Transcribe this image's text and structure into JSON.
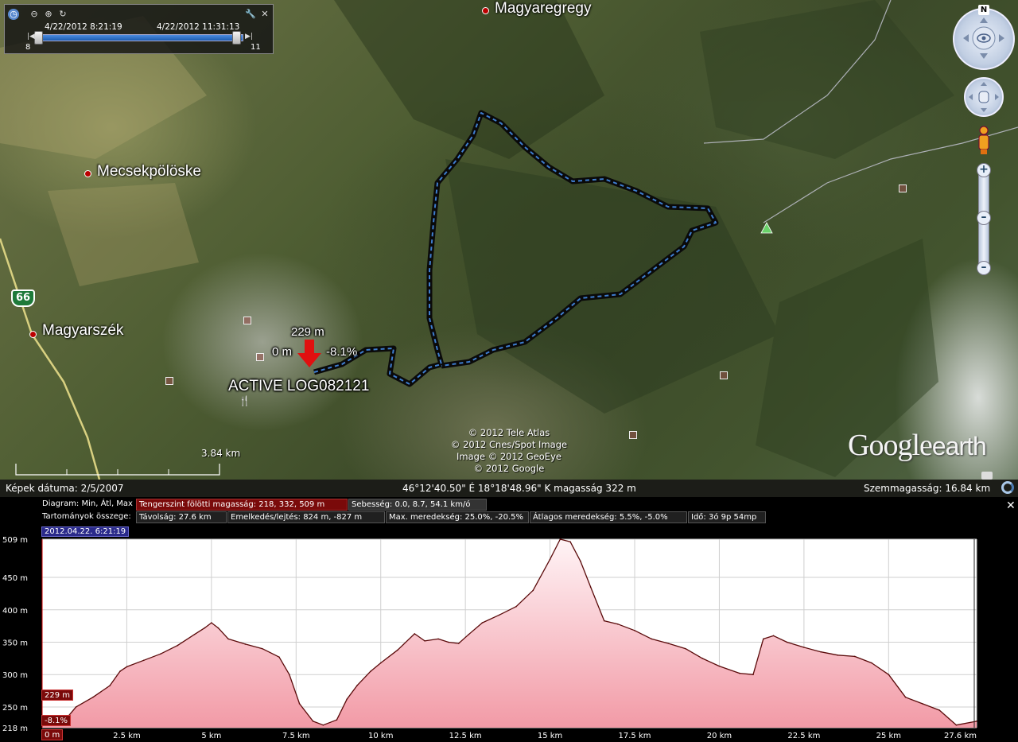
{
  "time_slider": {
    "start_label": "4/22/2012   8:21:19",
    "end_label": "4/22/2012   11:31:13",
    "left_number": "8",
    "right_number": "11",
    "icons": [
      "clock-icon",
      "zoom-out-icon",
      "zoom-in-icon",
      "playback-icon",
      "wrench-icon",
      "close-icon"
    ]
  },
  "map": {
    "places": [
      {
        "name": "Magyaregregy"
      },
      {
        "name": "Mecsekpölöske"
      },
      {
        "name": "Magyarszék"
      }
    ],
    "road_number": "66",
    "track": {
      "start_elev": "229 m",
      "distance": "0 m",
      "slope": "-8.1%",
      "name": "ACTIVE LOG082121"
    },
    "copyright": [
      "© 2012 Tele Atlas",
      "© 2012 Cnes/Spot Image",
      "Image © 2012 GeoEye",
      "© 2012 Google"
    ],
    "logo_google": "Google",
    "logo_earth": "earth",
    "scale_text": "3.84 km",
    "compass_north": "N"
  },
  "status_bar": {
    "image_date": "Képek dátuma: 2/5/2007",
    "coords": "46°12'40.50\" É   18°18'48.96\" K  magasság   322 m",
    "eye_alt": "Szemmagasság:    16.84 km"
  },
  "profile": {
    "row1": {
      "label": "Diagram: Min, Átl, Max",
      "elevation": "Tengerszint fölötti magasság: 218, 332, 509 m",
      "speed": "Sebesség: 0.0, 8.7, 54.1 km/ó"
    },
    "row2": {
      "label": "Tartományok összege:",
      "distance": "Távolság: 27.6 km",
      "gain_loss": "Emelkedés/lejtés: 824 m, -827 m",
      "max_slope": "Max. meredekség: 25.0%, -20.5%",
      "avg_slope": "Átlagos meredekség: 5.5%, -5.0%",
      "time": "Idő: 3ó 9p 54mp"
    },
    "date_badge": "2012.04.22. 6:21:19",
    "cursor_elev": "229 m",
    "cursor_slope": "-8.1%",
    "cursor_dist": "0 m",
    "close_label": "✕"
  },
  "chart_data": {
    "type": "area",
    "title": "",
    "xlabel": "",
    "ylabel": "",
    "x_unit": "km",
    "y_unit": "m",
    "xlim": [
      0,
      27.6
    ],
    "ylim": [
      218,
      509
    ],
    "y_ticks": [
      "509 m",
      "450 m",
      "400 m",
      "350 m",
      "300 m",
      "250 m",
      "218 m"
    ],
    "y_tick_values": [
      509,
      450,
      400,
      350,
      300,
      250,
      218
    ],
    "x_ticks": [
      "0 m",
      "2.5 km",
      "5 km",
      "7.5 km",
      "10 km",
      "12.5 km",
      "15 km",
      "17.5 km",
      "20 km",
      "22.5 km",
      "25 km",
      "27.6 km"
    ],
    "x_tick_values": [
      0,
      2.5,
      5,
      7.5,
      10,
      12.5,
      15,
      17.5,
      20,
      22.5,
      25,
      27.6
    ],
    "series": [
      {
        "x": [
          0,
          0.3,
          0.6,
          1.0,
          1.5,
          2.0,
          2.3,
          2.5,
          3.0,
          3.5,
          4.0,
          4.5,
          4.8,
          5.0,
          5.2,
          5.5,
          6.0,
          6.5,
          7.0,
          7.3,
          7.6,
          8.0,
          8.3,
          8.7,
          9.0,
          9.3,
          9.7,
          10.0,
          10.5,
          11.0,
          11.3,
          11.7,
          12.0,
          12.3,
          12.6,
          13.0,
          13.5,
          14.0,
          14.5,
          15.0,
          15.3,
          15.6,
          15.9,
          16.2,
          16.6,
          17.0,
          17.5,
          18.0,
          18.5,
          19.0,
          19.5,
          20.0,
          20.6,
          21.0,
          21.3,
          21.6,
          22.0,
          22.5,
          23.0,
          23.5,
          24.0,
          24.5,
          25.0,
          25.5,
          26.0,
          26.5,
          27.0,
          27.6
        ],
        "y": [
          225,
          222,
          225,
          250,
          265,
          283,
          305,
          312,
          322,
          332,
          345,
          362,
          372,
          380,
          372,
          355,
          347,
          340,
          327,
          300,
          255,
          228,
          222,
          230,
          262,
          283,
          305,
          318,
          338,
          363,
          352,
          355,
          350,
          348,
          362,
          380,
          392,
          405,
          430,
          478,
          509,
          505,
          475,
          435,
          383,
          378,
          368,
          355,
          348,
          340,
          325,
          313,
          302,
          300,
          355,
          360,
          350,
          342,
          335,
          330,
          328,
          318,
          300,
          265,
          255,
          245,
          222,
          228
        ]
      }
    ],
    "grid": true
  }
}
